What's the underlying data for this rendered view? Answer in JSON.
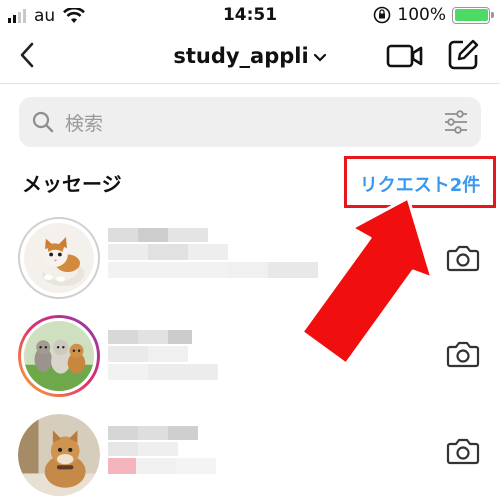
{
  "status_bar": {
    "carrier": "au",
    "time": "14:51",
    "battery": "100%",
    "battery_level": 1.0,
    "icons": [
      "signal-icon",
      "wifi-icon",
      "orientation-lock-icon",
      "battery-icon"
    ]
  },
  "nav": {
    "title": "study_appli",
    "title_dropdown_icon": "chevron-down-icon",
    "back_icon": "back-chevron-icon",
    "video_icon": "video-camera-icon",
    "compose_icon": "compose-icon"
  },
  "search": {
    "placeholder": "検索",
    "icon": "search-icon",
    "filter_icon": "filter-sliders-icon"
  },
  "messages": {
    "section_label": "メッセージ",
    "request_link": "リクエスト2件",
    "highlight_color": "#e8171b",
    "link_color": "#3897f0"
  },
  "conversations": [
    {
      "avatar": "kitten-photo",
      "story_ring": "none",
      "camera_icon": "camera-icon"
    },
    {
      "avatar": "kittens-group-photo",
      "story_ring": "gradient",
      "camera_icon": "camera-icon"
    },
    {
      "avatar": "tabby-cat-photo",
      "story_ring": "none",
      "camera_icon": "camera-icon"
    }
  ]
}
